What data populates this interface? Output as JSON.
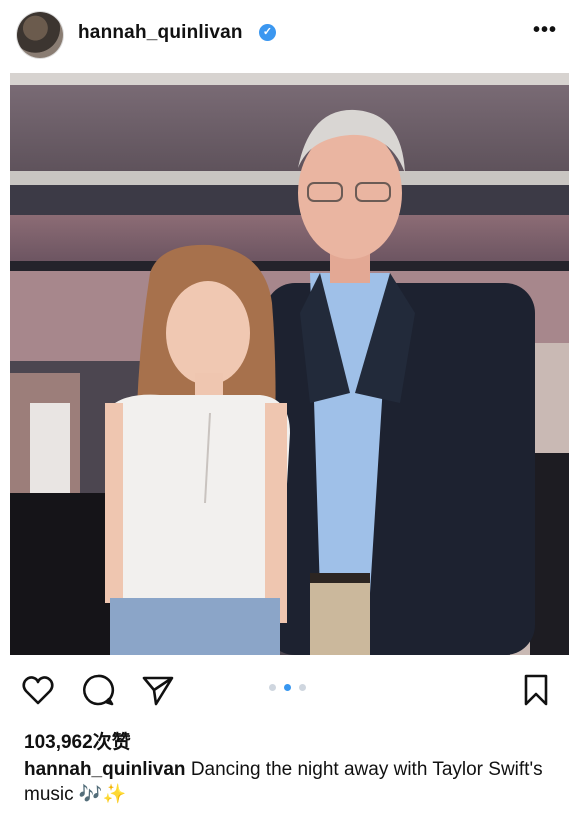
{
  "post": {
    "username": "hannah_quinlivan",
    "verified_mark": "✓",
    "more_label": "•••",
    "likes_count": "103,962",
    "likes_suffix": "次赞",
    "caption_user": "hannah_quinlivan",
    "caption_text": "Dancing the night away with Taylor Swift's music",
    "caption_emoji_notes": "🎶",
    "caption_emoji_sparkle": "✨",
    "carousel": {
      "total": 3,
      "active_index": 1
    }
  },
  "icons": {
    "like": "heart-icon",
    "comment": "comment-icon",
    "share": "send-icon",
    "save": "bookmark-icon"
  },
  "colors": {
    "verified": "#3b97f0",
    "carousel_active": "#3897f0",
    "carousel_inactive": "#cfd6df"
  }
}
